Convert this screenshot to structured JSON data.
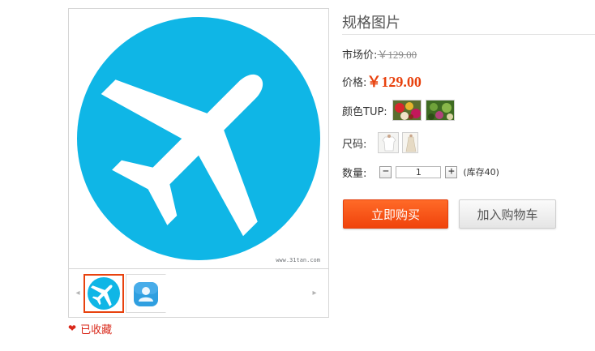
{
  "gallery": {
    "watermark": "www.31tan.com",
    "prev_arrow": "◂",
    "next_arrow": "▸",
    "thumbnails": [
      {
        "icon": "airplane-icon",
        "selected": true
      },
      {
        "icon": "user-icon",
        "selected": false
      }
    ],
    "favorite_label": "已收藏",
    "favorite_icon": "heart-icon"
  },
  "product": {
    "title": "规格图片",
    "market_price_label": "市场价:",
    "market_price": "￥129.00",
    "price_label": "价格:",
    "price": "￥129.00",
    "color_label": "颜色TUP:",
    "size_label": "尺码:",
    "quantity_label": "数量:",
    "quantity_value": "1",
    "decrement": "−",
    "increment": "+",
    "stock": "(库存40)"
  },
  "actions": {
    "buy_now": "立即购买",
    "add_to_cart": "加入购物车"
  },
  "colors": {
    "accent": "#e8420e",
    "icon_blue": "#0fb6e6",
    "favorite": "#d9281a"
  }
}
